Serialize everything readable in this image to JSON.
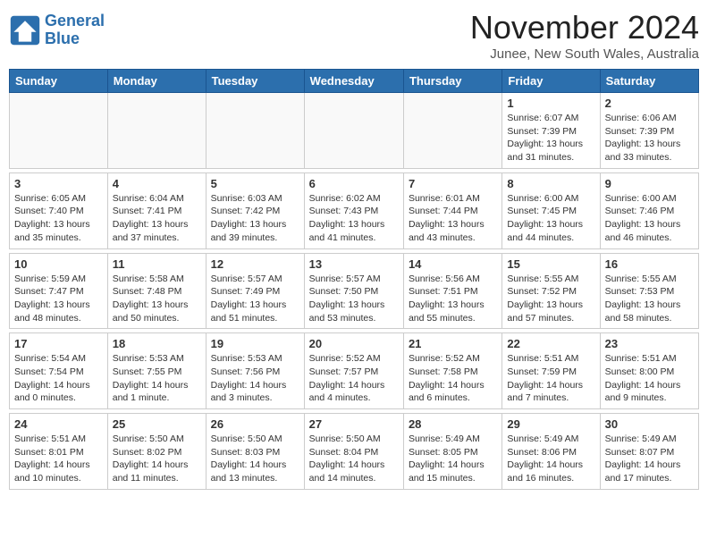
{
  "header": {
    "logo_line1": "General",
    "logo_line2": "Blue",
    "month_title": "November 2024",
    "location": "Junee, New South Wales, Australia"
  },
  "weekdays": [
    "Sunday",
    "Monday",
    "Tuesday",
    "Wednesday",
    "Thursday",
    "Friday",
    "Saturday"
  ],
  "weeks": [
    [
      {
        "day": "",
        "info": ""
      },
      {
        "day": "",
        "info": ""
      },
      {
        "day": "",
        "info": ""
      },
      {
        "day": "",
        "info": ""
      },
      {
        "day": "",
        "info": ""
      },
      {
        "day": "1",
        "info": "Sunrise: 6:07 AM\nSunset: 7:39 PM\nDaylight: 13 hours\nand 31 minutes."
      },
      {
        "day": "2",
        "info": "Sunrise: 6:06 AM\nSunset: 7:39 PM\nDaylight: 13 hours\nand 33 minutes."
      }
    ],
    [
      {
        "day": "3",
        "info": "Sunrise: 6:05 AM\nSunset: 7:40 PM\nDaylight: 13 hours\nand 35 minutes."
      },
      {
        "day": "4",
        "info": "Sunrise: 6:04 AM\nSunset: 7:41 PM\nDaylight: 13 hours\nand 37 minutes."
      },
      {
        "day": "5",
        "info": "Sunrise: 6:03 AM\nSunset: 7:42 PM\nDaylight: 13 hours\nand 39 minutes."
      },
      {
        "day": "6",
        "info": "Sunrise: 6:02 AM\nSunset: 7:43 PM\nDaylight: 13 hours\nand 41 minutes."
      },
      {
        "day": "7",
        "info": "Sunrise: 6:01 AM\nSunset: 7:44 PM\nDaylight: 13 hours\nand 43 minutes."
      },
      {
        "day": "8",
        "info": "Sunrise: 6:00 AM\nSunset: 7:45 PM\nDaylight: 13 hours\nand 44 minutes."
      },
      {
        "day": "9",
        "info": "Sunrise: 6:00 AM\nSunset: 7:46 PM\nDaylight: 13 hours\nand 46 minutes."
      }
    ],
    [
      {
        "day": "10",
        "info": "Sunrise: 5:59 AM\nSunset: 7:47 PM\nDaylight: 13 hours\nand 48 minutes."
      },
      {
        "day": "11",
        "info": "Sunrise: 5:58 AM\nSunset: 7:48 PM\nDaylight: 13 hours\nand 50 minutes."
      },
      {
        "day": "12",
        "info": "Sunrise: 5:57 AM\nSunset: 7:49 PM\nDaylight: 13 hours\nand 51 minutes."
      },
      {
        "day": "13",
        "info": "Sunrise: 5:57 AM\nSunset: 7:50 PM\nDaylight: 13 hours\nand 53 minutes."
      },
      {
        "day": "14",
        "info": "Sunrise: 5:56 AM\nSunset: 7:51 PM\nDaylight: 13 hours\nand 55 minutes."
      },
      {
        "day": "15",
        "info": "Sunrise: 5:55 AM\nSunset: 7:52 PM\nDaylight: 13 hours\nand 57 minutes."
      },
      {
        "day": "16",
        "info": "Sunrise: 5:55 AM\nSunset: 7:53 PM\nDaylight: 13 hours\nand 58 minutes."
      }
    ],
    [
      {
        "day": "17",
        "info": "Sunrise: 5:54 AM\nSunset: 7:54 PM\nDaylight: 14 hours\nand 0 minutes."
      },
      {
        "day": "18",
        "info": "Sunrise: 5:53 AM\nSunset: 7:55 PM\nDaylight: 14 hours\nand 1 minute."
      },
      {
        "day": "19",
        "info": "Sunrise: 5:53 AM\nSunset: 7:56 PM\nDaylight: 14 hours\nand 3 minutes."
      },
      {
        "day": "20",
        "info": "Sunrise: 5:52 AM\nSunset: 7:57 PM\nDaylight: 14 hours\nand 4 minutes."
      },
      {
        "day": "21",
        "info": "Sunrise: 5:52 AM\nSunset: 7:58 PM\nDaylight: 14 hours\nand 6 minutes."
      },
      {
        "day": "22",
        "info": "Sunrise: 5:51 AM\nSunset: 7:59 PM\nDaylight: 14 hours\nand 7 minutes."
      },
      {
        "day": "23",
        "info": "Sunrise: 5:51 AM\nSunset: 8:00 PM\nDaylight: 14 hours\nand 9 minutes."
      }
    ],
    [
      {
        "day": "24",
        "info": "Sunrise: 5:51 AM\nSunset: 8:01 PM\nDaylight: 14 hours\nand 10 minutes."
      },
      {
        "day": "25",
        "info": "Sunrise: 5:50 AM\nSunset: 8:02 PM\nDaylight: 14 hours\nand 11 minutes."
      },
      {
        "day": "26",
        "info": "Sunrise: 5:50 AM\nSunset: 8:03 PM\nDaylight: 14 hours\nand 13 minutes."
      },
      {
        "day": "27",
        "info": "Sunrise: 5:50 AM\nSunset: 8:04 PM\nDaylight: 14 hours\nand 14 minutes."
      },
      {
        "day": "28",
        "info": "Sunrise: 5:49 AM\nSunset: 8:05 PM\nDaylight: 14 hours\nand 15 minutes."
      },
      {
        "day": "29",
        "info": "Sunrise: 5:49 AM\nSunset: 8:06 PM\nDaylight: 14 hours\nand 16 minutes."
      },
      {
        "day": "30",
        "info": "Sunrise: 5:49 AM\nSunset: 8:07 PM\nDaylight: 14 hours\nand 17 minutes."
      }
    ]
  ]
}
